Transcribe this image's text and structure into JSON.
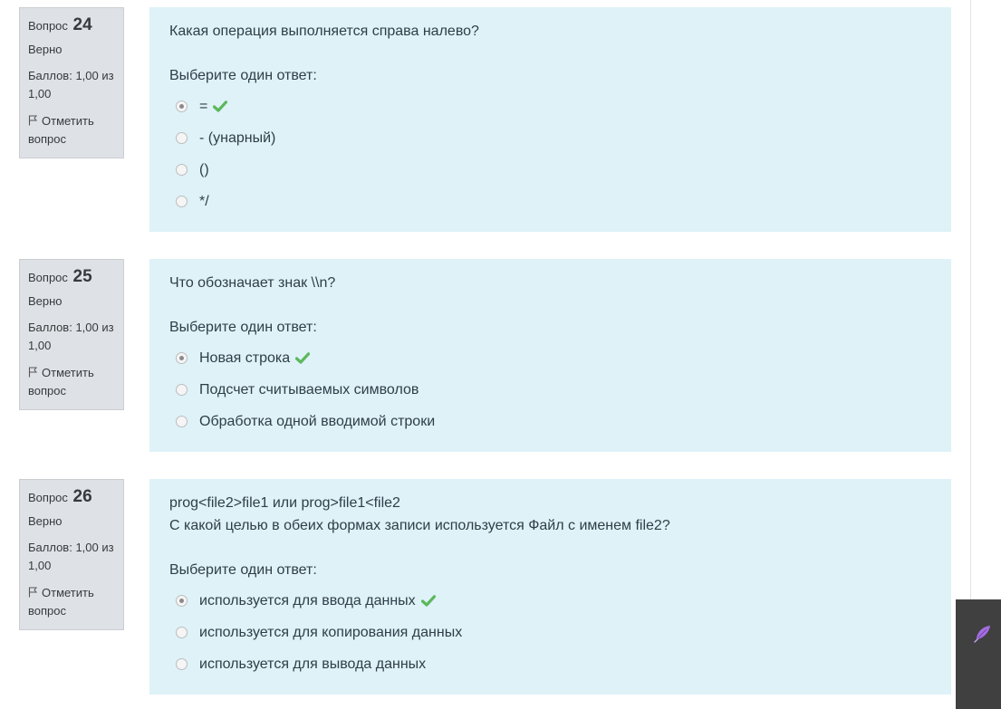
{
  "questions": [
    {
      "label": "Вопрос",
      "number": "24",
      "state": "Верно",
      "grade": "Баллов: 1,00 из 1,00",
      "flag": "Отметить вопрос",
      "text": "Какая операция выполняется справа налево?",
      "text2": "",
      "prompt": "Выберите один ответ:",
      "answers": [
        {
          "label": "=",
          "selected": true,
          "correct": true
        },
        {
          "label": "- (унарный)",
          "selected": false,
          "correct": false
        },
        {
          "label": "()",
          "selected": false,
          "correct": false
        },
        {
          "label": "*/",
          "selected": false,
          "correct": false
        }
      ]
    },
    {
      "label": "Вопрос",
      "number": "25",
      "state": "Верно",
      "grade": "Баллов: 1,00 из 1,00",
      "flag": "Отметить вопрос",
      "text": "Что обозначает знак \\\\n?",
      "text2": "",
      "prompt": "Выберите один ответ:",
      "answers": [
        {
          "label": "Новая строка",
          "selected": true,
          "correct": true
        },
        {
          "label": "Подсчет считываемых символов",
          "selected": false,
          "correct": false
        },
        {
          "label": "Обработка одной вводимой строки",
          "selected": false,
          "correct": false
        }
      ]
    },
    {
      "label": "Вопрос",
      "number": "26",
      "state": "Верно",
      "grade": "Баллов: 1,00 из 1,00",
      "flag": "Отметить вопрос",
      "text": "prog<file2>file1 или prog>file1<file2",
      "text2": "С какой целью в обеих формах записи используется Файл с именем file2?",
      "prompt": "Выберите один ответ:",
      "answers": [
        {
          "label": "используется для ввода данных",
          "selected": true,
          "correct": true
        },
        {
          "label": "используется для копирования данных",
          "selected": false,
          "correct": false
        },
        {
          "label": "используется для вывода данных",
          "selected": false,
          "correct": false
        }
      ]
    }
  ],
  "icons": {
    "flag": "flag-icon",
    "correct": "check-icon",
    "dock": "feather-icon"
  },
  "colors": {
    "info_bg": "#dee2e6",
    "content_bg": "#def2f8",
    "correct": "#5cb85c",
    "dock_bg": "#404040",
    "dock_icon": "#a46ee0"
  }
}
